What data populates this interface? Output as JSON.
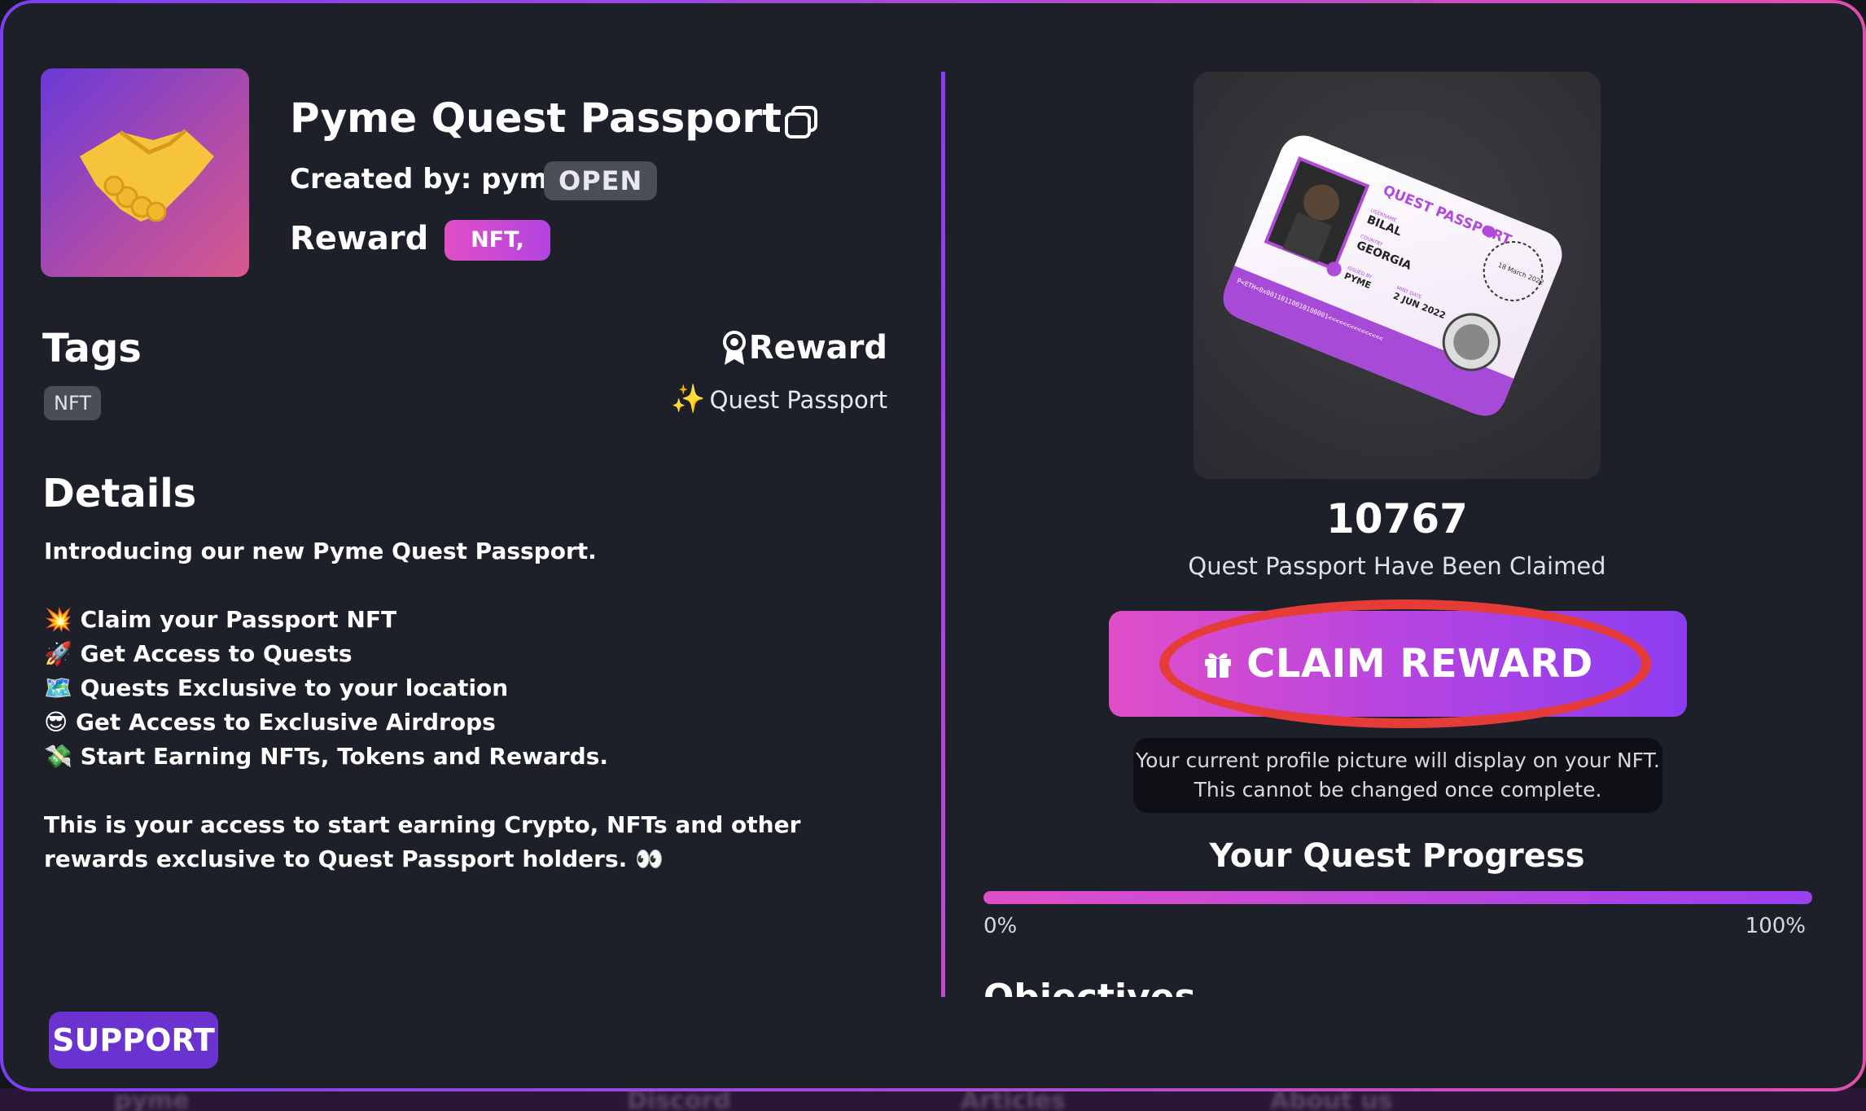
{
  "quest": {
    "title": "Pyme Quest Passport",
    "created_by": "Created by: pyme",
    "status": "OPEN",
    "reward_label": "Reward",
    "reward_badge": "NFT,"
  },
  "tags": {
    "heading": "Tags",
    "items": [
      "NFT"
    ]
  },
  "reward_side": {
    "heading": "Reward",
    "item": "Quest Passport"
  },
  "details": {
    "heading": "Details",
    "intro": "Introducing our new Pyme Quest Passport.",
    "bullets": [
      {
        "emoji": "💥",
        "text": "Claim your Passport NFT"
      },
      {
        "emoji": "🚀",
        "text": "Get Access to Quests"
      },
      {
        "emoji": "🗺️",
        "text": "Quests Exclusive to your location"
      },
      {
        "emoji": "😎",
        "text": "Get Access to Exclusive Airdrops"
      },
      {
        "emoji": "💸",
        "text": "Start Earning NFTs, Tokens and Rewards."
      }
    ],
    "outro": "This is your access to start earning Crypto, NFTs and other rewards exclusive to Quest Passport holders. 👀"
  },
  "passport_card": {
    "header": "QUEST PASSPORT",
    "username_label": "USERNAME",
    "username": "BILAL",
    "country_label": "COUNTRY",
    "country": "GEORGIA",
    "issued_by_label": "ISSUED BY",
    "issued_by": "PYME",
    "mint_date_label": "MINT DATE",
    "mint_date": "2 JUN 2022",
    "stamp_text": "18 March 2022",
    "code_line": "P<ETH<0x00110110010100001<<<<<<<<<<<<<<<"
  },
  "claims": {
    "count": "10767",
    "caption": "Quest Passport Have Been Claimed"
  },
  "claim_button": {
    "label": "CLAIM REWARD"
  },
  "notice": {
    "line1": "Your current profile picture will display on your NFT.",
    "line2": "This cannot be changed once complete."
  },
  "progress": {
    "heading": "Your Quest Progress",
    "value_percent": 100,
    "min_label": "0%",
    "max_label": "100%"
  },
  "objectives": {
    "heading": "Objectives"
  },
  "support": {
    "label": "SUPPORT"
  },
  "bottom_nav": [
    "pyme",
    "Discord",
    "Articles",
    "About us"
  ],
  "colors": {
    "modal_bg": "#1d1f29",
    "accent_pink": "#e04fc8",
    "accent_purple": "#8b3df0",
    "highlight_ring": "#e53c3a",
    "support_bg": "#6a32cf"
  }
}
